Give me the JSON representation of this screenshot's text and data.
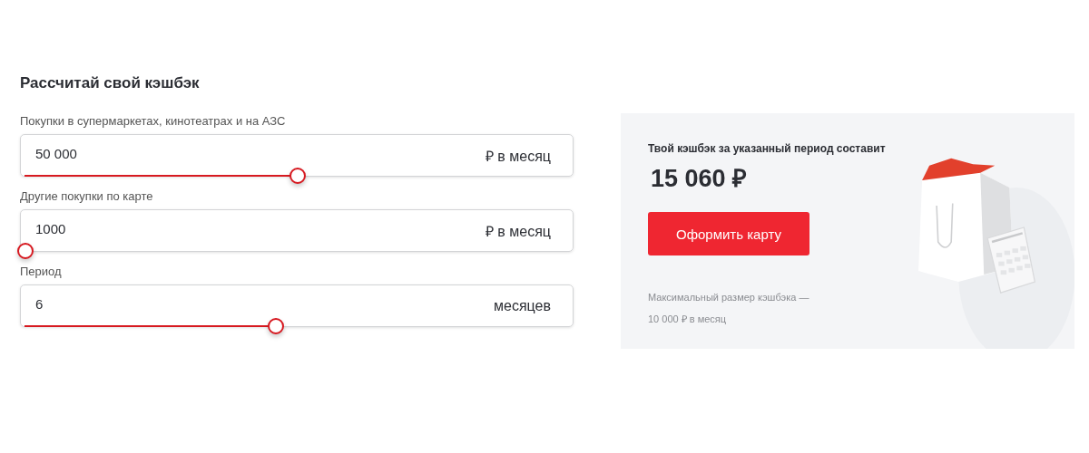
{
  "title": "Рассчитай свой кэшбэк",
  "fields": [
    {
      "label": "Покупки в супермаркетах, кинотеатрах и на АЗС",
      "value": "50 000",
      "unit": "₽ в месяц",
      "level": 0.5
    },
    {
      "label": "Другие покупки по карте",
      "value": "1000",
      "unit": "₽ в месяц",
      "level": 0
    },
    {
      "label": "Период",
      "value": "6",
      "unit": "месяцев",
      "level": 0.46
    }
  ],
  "result": {
    "caption": "Твой кэшбэк за указанный период составит",
    "amount": "15 060 ₽",
    "button": "Оформить карту",
    "note": "Максимальный размер кэшбэка — 10 000 ₽ в месяц"
  }
}
